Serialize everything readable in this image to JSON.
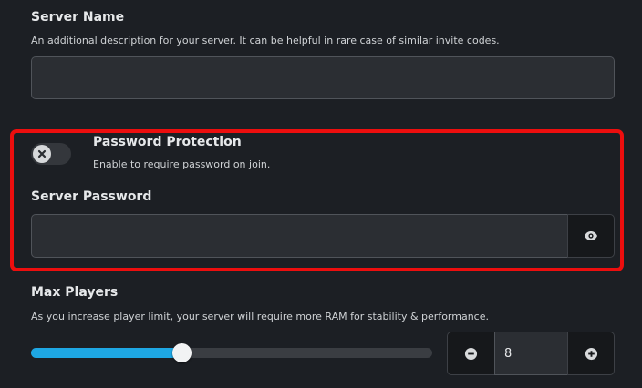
{
  "server_name": {
    "title": "Server Name",
    "description": "An additional description for your server. It can be helpful in rare case of similar invite codes.",
    "value": "",
    "placeholder": ""
  },
  "password_protection": {
    "title": "Password Protection",
    "description": "Enable to require password on join.",
    "toggle_icon": "x-icon",
    "enabled": false
  },
  "server_password": {
    "title": "Server Password",
    "value": "",
    "placeholder": "",
    "reveal_icon": "eye-icon"
  },
  "max_players": {
    "title": "Max Players",
    "description": "As you increase player limit, your server will require more RAM for stability & performance.",
    "value": "8",
    "slider_fraction": 0.375,
    "decrement_icon": "minus-circle-icon",
    "increment_icon": "plus-circle-icon"
  },
  "colors": {
    "background": "#1c1f24",
    "highlight": "#ec0e0e",
    "accent": "#1ea7e4"
  }
}
